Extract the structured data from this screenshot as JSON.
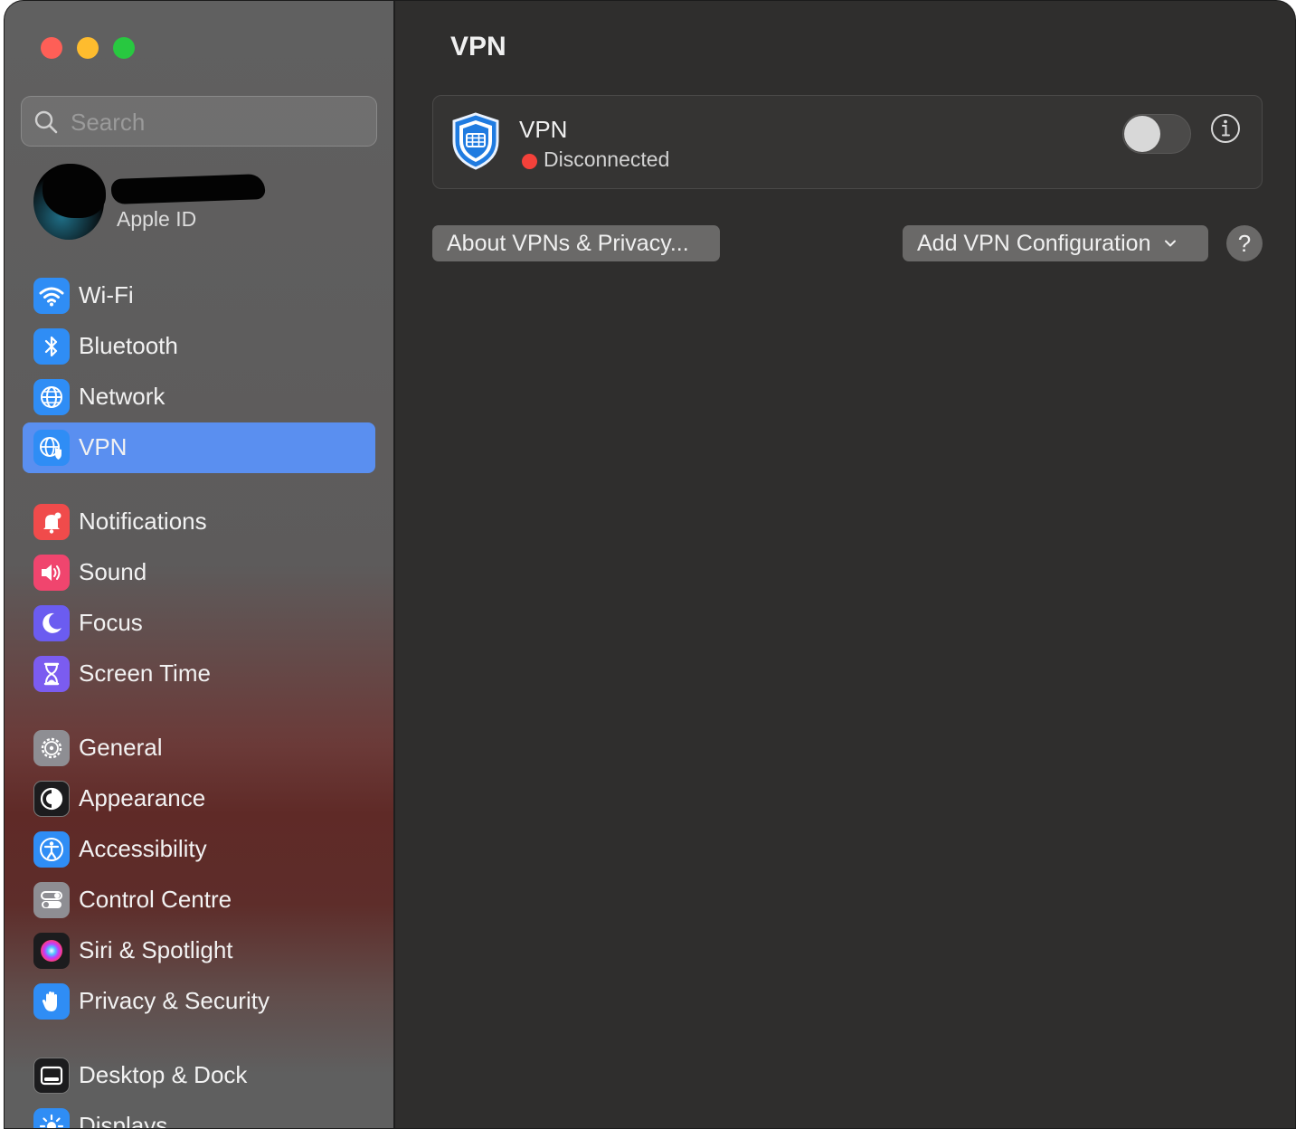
{
  "window": {
    "traffic_lights": [
      "close",
      "minimize",
      "zoom"
    ]
  },
  "sidebar": {
    "search_placeholder": "Search",
    "profile": {
      "subtitle": "Apple ID"
    },
    "items": [
      {
        "label": "Wi-Fi",
        "icon": "wifi-icon",
        "color": "#2f8df5"
      },
      {
        "label": "Bluetooth",
        "icon": "bluetooth-icon",
        "color": "#2f8df5"
      },
      {
        "label": "Network",
        "icon": "globe-icon",
        "color": "#2f8df5"
      },
      {
        "label": "VPN",
        "icon": "vpn-globe-icon",
        "color": "#2f8df5",
        "selected": true
      },
      {
        "label": "Notifications",
        "icon": "bell-icon",
        "color": "#f04b4b"
      },
      {
        "label": "Sound",
        "icon": "speaker-icon",
        "color": "#f0456e"
      },
      {
        "label": "Focus",
        "icon": "moon-icon",
        "color": "#6b5cf0"
      },
      {
        "label": "Screen Time",
        "icon": "hourglass-icon",
        "color": "#7b5cf0"
      },
      {
        "label": "General",
        "icon": "gear-icon",
        "color": "#8e8e93"
      },
      {
        "label": "Appearance",
        "icon": "appearance-icon",
        "color": "#1c1c1e"
      },
      {
        "label": "Accessibility",
        "icon": "accessibility-icon",
        "color": "#2f8df5"
      },
      {
        "label": "Control Centre",
        "icon": "toggles-icon",
        "color": "#8e8e93"
      },
      {
        "label": "Siri & Spotlight",
        "icon": "siri-icon",
        "color": "#1c1c1e"
      },
      {
        "label": "Privacy & Security",
        "icon": "hand-icon",
        "color": "#2f8df5"
      },
      {
        "label": "Desktop & Dock",
        "icon": "dock-icon",
        "color": "#1c1c1e"
      },
      {
        "label": "Displays",
        "icon": "sun-icon",
        "color": "#2f8df5"
      }
    ]
  },
  "main": {
    "title": "VPN",
    "vpn": {
      "name": "VPN",
      "status": "Disconnected",
      "status_color": "#f4413a",
      "enabled": false
    },
    "about_button": "About VPNs & Privacy...",
    "add_button": "Add VPN Configuration",
    "help_button": "?"
  }
}
